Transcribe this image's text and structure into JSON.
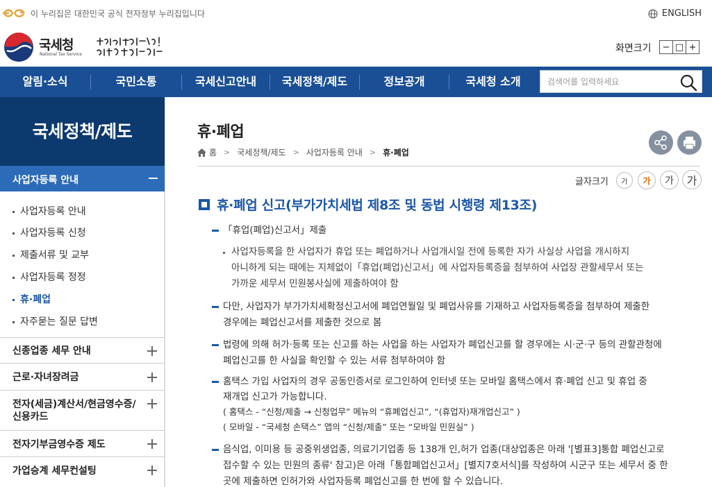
{
  "gov_banner": {
    "text": "이 누리집은 대한민국 공식 전자정부 누리집입니다"
  },
  "language": {
    "label": "ENGLISH"
  },
  "header": {
    "logo_name": "국세청",
    "logo_sub": "National Tax Service",
    "zoom_label": "화면크기",
    "zoom_minus": "−",
    "zoom_reset": "□",
    "zoom_plus": "+"
  },
  "gnb": {
    "items": [
      "알림·소식",
      "국민소통",
      "국세신고안내",
      "국세정책/제도",
      "정보공개",
      "국세청 소개"
    ],
    "search_placeholder": "검색어를 입력하세요"
  },
  "sidebar": {
    "title": "국세정책/제도",
    "active_section": "사업자등록 안내",
    "sub_items": [
      "사업자등록 안내",
      "사업자등록 신청",
      "제출서류 및 교부",
      "사업자등록 정정",
      "휴·폐업",
      "자주묻는 질문 답변"
    ],
    "current_sub": 4,
    "menus": [
      "신종업종 세무 안내",
      "근로·자녀장려금",
      "전자(세금)계산서/현금영수증/",
      "신용카드",
      "전자기부금영수증 제도",
      "가업승계 세무컨설팅"
    ]
  },
  "content": {
    "page_title": "휴·폐업",
    "breadcrumb": [
      "홈",
      "국세정책/제도",
      "사업자등록 안내",
      "휴·폐업"
    ],
    "fontsize_label": "글자크기",
    "fontsize_glyph": "가",
    "heading": "휴·폐업 신고(부가가치세법 제8조 및 동법 시행령 제13조)",
    "items": [
      {
        "lines": [
          "「휴업(폐업)신고서」제출"
        ]
      },
      {
        "lines": [
          "사업자등록을 한 사업자가 휴업 또는 폐업하거나 사업개시일 전에 등록한 자가 사실상 사업을 개시하지",
          "아니하게 되는 때에는 지체없이「휴업(폐업)신고서」에 사업자등록증을 첨부하여 사업장 관할세무서 또는",
          "가까운 세무서 민원봉사실에 제출하여야 함"
        ]
      },
      {
        "lines": [
          "다만, 사업자가 부가가치세확정신고서에 폐업연월일 및 폐업사유를 기재하고 사업자등록증을 첨부하여 제출한",
          "경우에는 폐업신고서를 제출한 것으로 봄"
        ]
      },
      {
        "lines": [
          "법령에 의해 허가·등록 또는 신고를 하는 사업을 하는 사업자가 폐업신고를 할 경우에는 시·군·구 등의 관할관청에",
          "폐업신고를 한 사실을 확인할 수 있는 서류 첨부하여야 함"
        ]
      },
      {
        "lines": [
          "홈택스 가입 사업자의 경우 공동인증서로 로그인하여 인터넷 또는 모바일 홈택스에서 휴·폐업 신고 및 휴업 중",
          "재개업 신고가 가능합니다.",
          "( 홈택스 - “신청/제출 → 신청업무” 메뉴의 “휴폐업신고”, “(휴업자)재개업신고” )",
          "( 모바일 - “국세청 손택스” 앱의 “신청/제출” 또는 “모바일 민원실” )"
        ]
      },
      {
        "lines": [
          "음식업, 이미용 등 공중위생업종, 의료기기업종 등 138개 인,허가 업종(대상업종은 아래 '[별표3]통합 폐업신고로",
          "접수할 수 있는 민원의 종류' 참고)은 아래「통합폐업신고서」[별지7호서식]를 작성하여 시군구 또는 세무서 중 한",
          "곳에 제출하면 인허가와 사업자등록 폐업신고를 한 번에 할 수 있습니다."
        ]
      }
    ]
  },
  "colors": {
    "gnb": "#1a4f96",
    "side_title": "#0d3a6e",
    "side_active": "#2c6bb8",
    "accent": "#1a56a6",
    "fontsize_on": "#e06a00"
  }
}
